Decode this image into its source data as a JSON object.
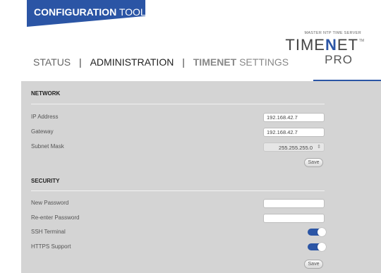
{
  "banner": {
    "bold": "CONFIGURATION",
    "light": "TOOL"
  },
  "logo": {
    "tagline": "MASTER NTP TIME SERVER",
    "name_a": "TIME",
    "name_n": "N",
    "name_b": "ET",
    "tm": "TM",
    "pro": "PRO"
  },
  "nav": {
    "status": "STATUS",
    "separator": "|",
    "administration": "ADMINISTRATION",
    "timenet_bold": "TIMENET",
    "timenet_rest": " SETTINGS"
  },
  "network": {
    "title": "NETWORK",
    "ip_label": "IP Address",
    "ip_value": "192.168.42.7",
    "gateway_label": "Gateway",
    "gateway_value": "192.168.42.7",
    "subnet_label": "Subnet Mask",
    "subnet_value": "255.255.255.0",
    "save_label": "Save"
  },
  "security": {
    "title": "SECURITY",
    "new_password_label": "New Password",
    "new_password_value": "",
    "reenter_password_label": "Re-enter Password",
    "reenter_password_value": "",
    "ssh_label": "SSH Terminal",
    "ssh_enabled": true,
    "https_label": "HTTPS Support",
    "https_enabled": true,
    "save_label": "Save"
  },
  "colors": {
    "accent": "#2b55a5",
    "panel": "#d4d4d4"
  },
  "icons": {
    "stepper": "updown-icon"
  }
}
